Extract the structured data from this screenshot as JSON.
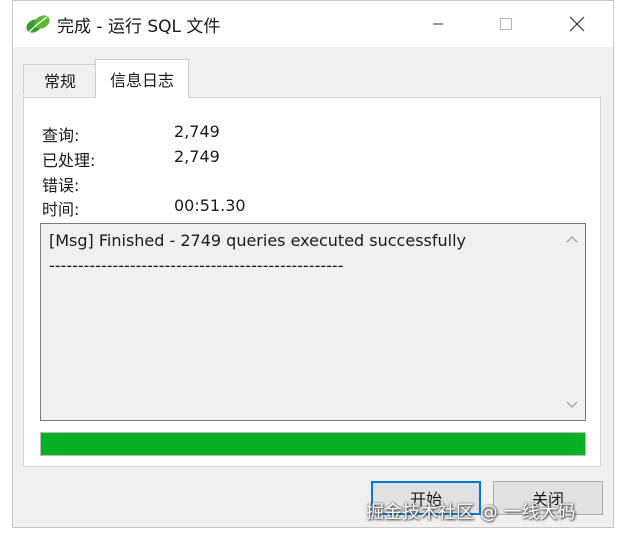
{
  "window": {
    "title": "完成 - 运行 SQL 文件"
  },
  "tabs": [
    {
      "label": "常规"
    },
    {
      "label": "信息日志"
    }
  ],
  "stats": [
    {
      "label": "查询:",
      "value": "2,749"
    },
    {
      "label": "已处理:",
      "value": "2,749"
    },
    {
      "label": "错误:",
      "value": ""
    },
    {
      "label": "时间:",
      "value": "00:51.30"
    }
  ],
  "log": {
    "lines": [
      "[Msg] Finished - 2749 queries executed successfully",
      "---------------------------------------------------"
    ]
  },
  "progress": {
    "fraction": 1.0,
    "color": "#06b025"
  },
  "buttons": {
    "start_label": "开始",
    "close_label": "关闭"
  },
  "watermark": "掘金技术社区 @ 一线大码",
  "colors": {
    "accent": "#0078d7",
    "icon_green": "#3a9a2a"
  }
}
